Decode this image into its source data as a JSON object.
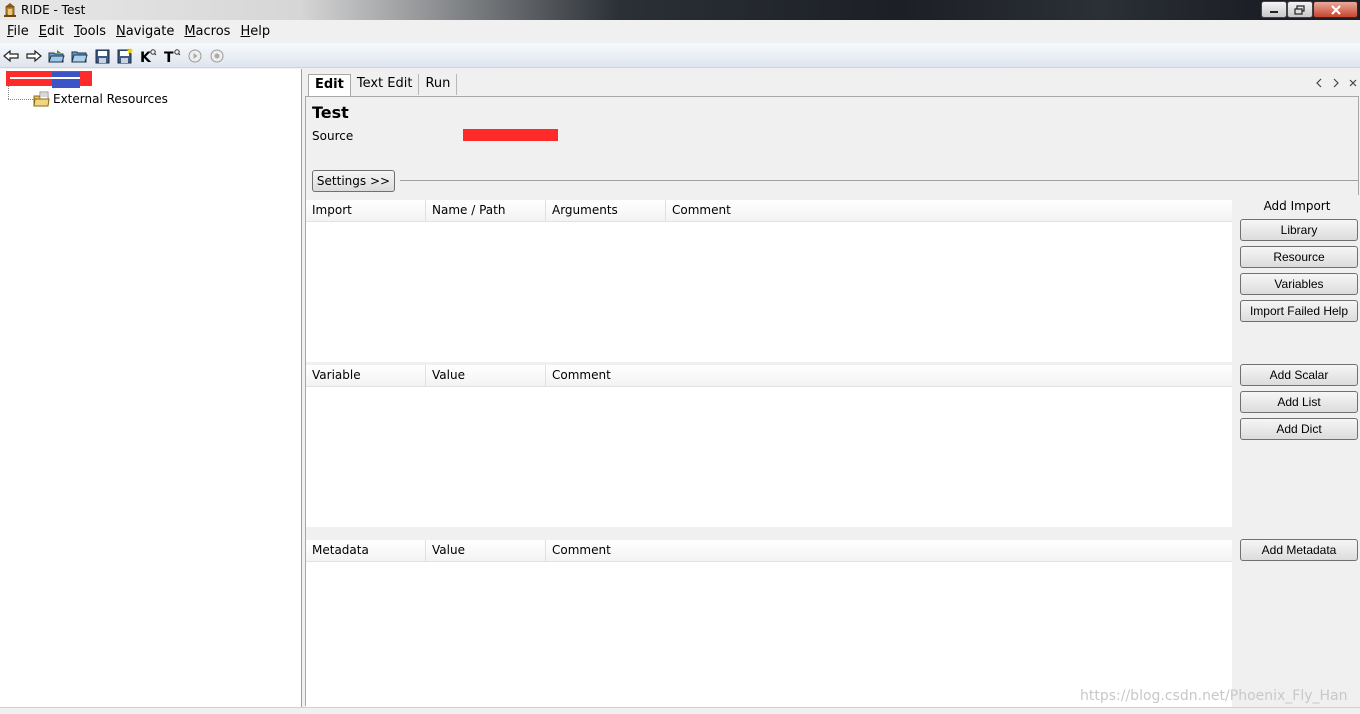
{
  "window": {
    "title": "RIDE - Test",
    "icon": "ride-logo-icon"
  },
  "menu": {
    "items": [
      {
        "label": "File",
        "mnemonic": "F",
        "rest": "ile"
      },
      {
        "label": "Edit",
        "mnemonic": "E",
        "rest": "dit"
      },
      {
        "label": "Tools",
        "mnemonic": "T",
        "rest": "ools"
      },
      {
        "label": "Navigate",
        "mnemonic": "N",
        "rest": "avigate"
      },
      {
        "label": "Macros",
        "mnemonic": "M",
        "rest": "acros"
      },
      {
        "label": "Help",
        "mnemonic": "H",
        "rest": "elp"
      }
    ]
  },
  "toolbar": {
    "icons": [
      "back-arrow-icon",
      "forward-arrow-icon",
      "open-project-icon",
      "open-folder-icon",
      "save-icon",
      "save-all-icon",
      "search-keywords-icon",
      "search-tests-icon",
      "run-icon",
      "stop-icon"
    ],
    "keyword_search_label": "K",
    "test_search_label": "T"
  },
  "tree": {
    "external_resources": "External Resources"
  },
  "editor": {
    "tabs": [
      {
        "label": "Edit",
        "active": true
      },
      {
        "label": "Text Edit",
        "active": false
      },
      {
        "label": "Run",
        "active": false
      }
    ],
    "file_title": "Test",
    "source_label": "Source",
    "settings_button": "Settings >>",
    "import_grid": {
      "columns": [
        "Import",
        "Name / Path",
        "Arguments",
        "Comment"
      ]
    },
    "variable_grid": {
      "columns": [
        "Variable",
        "Value",
        "Comment"
      ]
    },
    "metadata_grid": {
      "columns": [
        "Metadata",
        "Value",
        "Comment"
      ]
    },
    "add_import_label": "Add Import",
    "buttons": {
      "library": "Library",
      "resource": "Resource",
      "variables": "Variables",
      "import_failed_help": "Import Failed Help",
      "add_scalar": "Add Scalar",
      "add_list": "Add List",
      "add_dict": "Add Dict",
      "add_metadata": "Add Metadata"
    }
  },
  "watermark": "https://blog.csdn.net/Phoenix_Fly_Han",
  "colors": {
    "redaction": "#ff2a2a",
    "selection": "#3b55c7"
  }
}
